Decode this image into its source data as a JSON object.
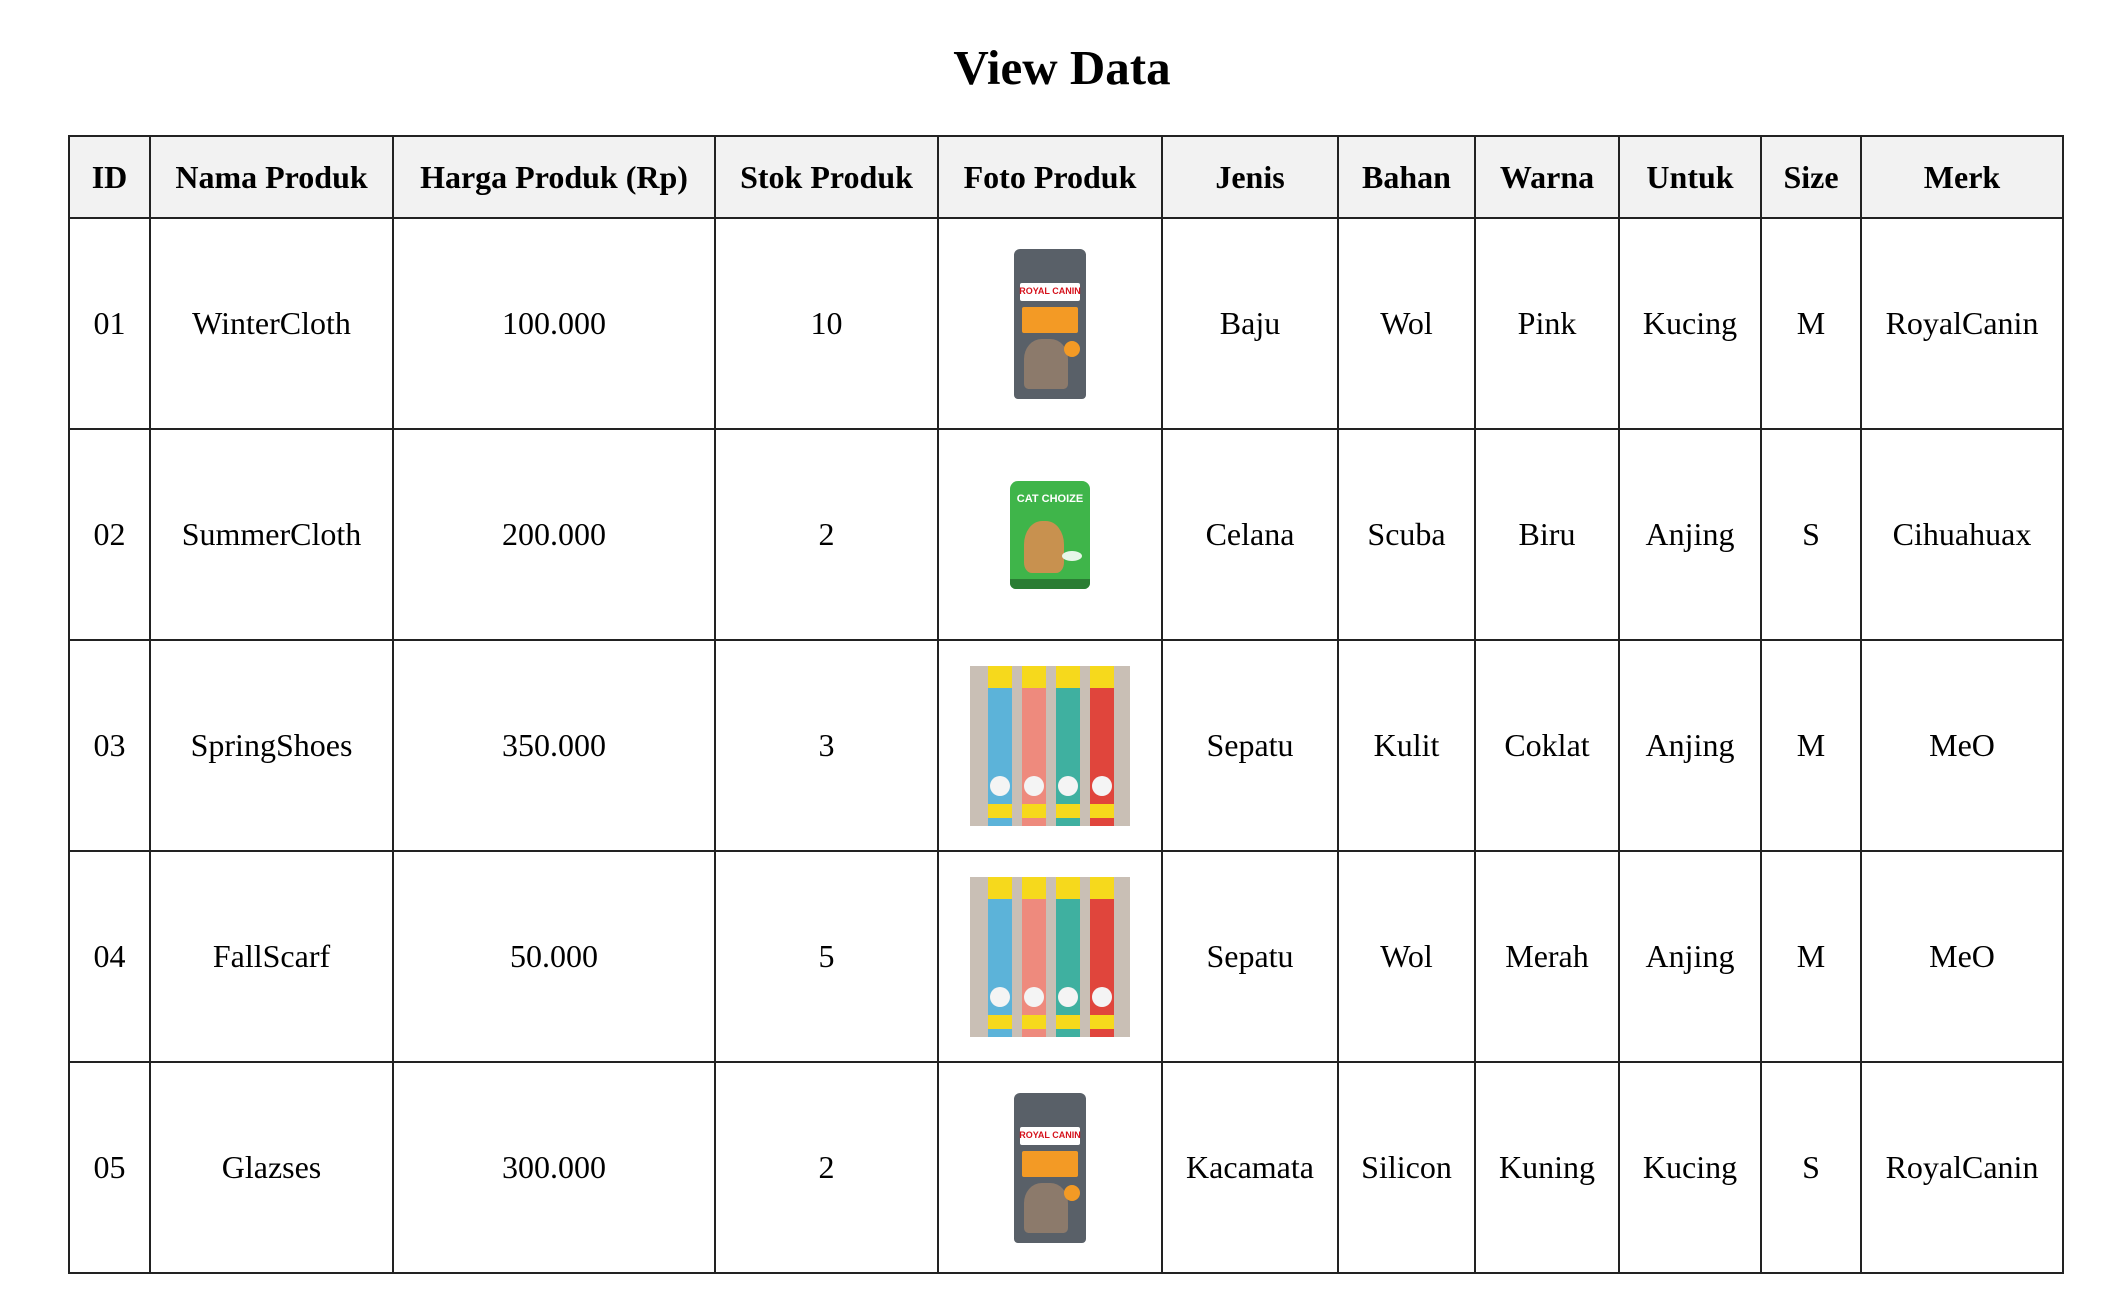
{
  "page": {
    "title": "View Data"
  },
  "table": {
    "headers": [
      "ID",
      "Nama Produk",
      "Harga Produk (Rp)",
      "Stok Produk",
      "Foto Produk",
      "Jenis",
      "Bahan",
      "Warna",
      "Untuk",
      "Size",
      "Merk"
    ],
    "rows": [
      {
        "id": "01",
        "nama": "WinterCloth",
        "harga": "100.000",
        "stok": "10",
        "foto": "royal-canin-bag",
        "jenis": "Baju",
        "bahan": "Wol",
        "warna": "Pink",
        "untuk": "Kucing",
        "size": "M",
        "merk": "RoyalCanin"
      },
      {
        "id": "02",
        "nama": "SummerCloth",
        "harga": "200.000",
        "stok": "2",
        "foto": "cat-choize-bag",
        "jenis": "Celana",
        "bahan": "Scuba",
        "warna": "Biru",
        "untuk": "Anjing",
        "size": "S",
        "merk": "Cihuahuax"
      },
      {
        "id": "03",
        "nama": "SpringShoes",
        "harga": "350.000",
        "stok": "3",
        "foto": "meo-treats",
        "jenis": "Sepatu",
        "bahan": "Kulit",
        "warna": "Coklat",
        "untuk": "Anjing",
        "size": "M",
        "merk": "MeO"
      },
      {
        "id": "04",
        "nama": "FallScarf",
        "harga": "50.000",
        "stok": "5",
        "foto": "meo-treats",
        "jenis": "Sepatu",
        "bahan": "Wol",
        "warna": "Merah",
        "untuk": "Anjing",
        "size": "M",
        "merk": "MeO"
      },
      {
        "id": "05",
        "nama": "Glazses",
        "harga": "300.000",
        "stok": "2",
        "foto": "royal-canin-bag",
        "jenis": "Kacamata",
        "bahan": "Silicon",
        "warna": "Kuning",
        "untuk": "Kucing",
        "size": "S",
        "merk": "RoyalCanin"
      }
    ]
  },
  "product_images": {
    "royal_canin": {
      "logo": "ROYAL CANIN"
    },
    "cat_choize": {
      "logo": "CAT CHOIZE"
    }
  },
  "colors": {
    "header_bg": "#f2f2f2",
    "border": "#222222"
  }
}
